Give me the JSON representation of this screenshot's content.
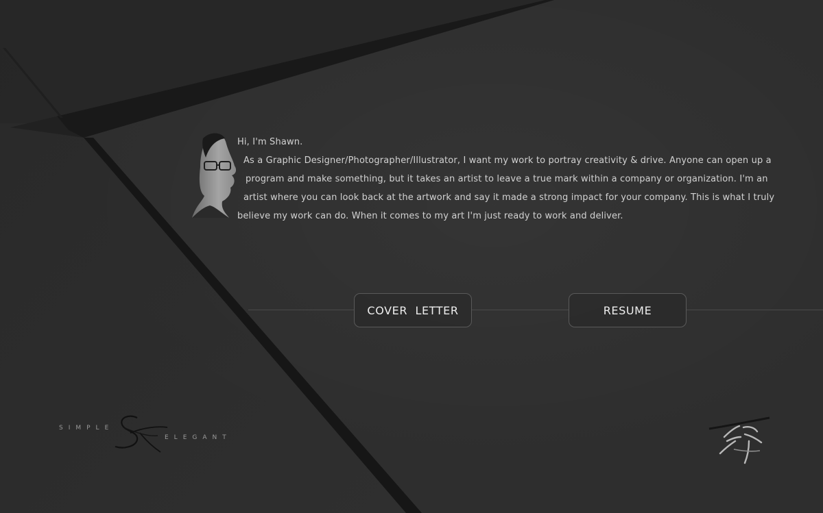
{
  "intro": {
    "greeting": "Hi, I'm Shawn.",
    "lines": [
      "As a Graphic Designer/Photographer/Illustrator, I want my work to portray creativity & drive. Anyone can open up a",
      " program and make something, but it takes an artist to leave a true mark within a company or organization. I'm an",
      "artist where you can look back at the artwork and say it made a strong impact for your company. This is what I truly",
      "believe my work can do. When it comes to my art I'm just ready to work and deliver."
    ]
  },
  "buttons": {
    "cover_letter": "COVER  LETTER",
    "resume": "RESUME"
  },
  "branding": {
    "logo_word_left": "SIMPLE",
    "logo_word_right": "ELEGANT",
    "logo_monogram": "S&E",
    "signature_mark": "冷"
  },
  "colors": {
    "background": "#2e2e2e",
    "stripe": "#1c1c1c",
    "text": "#d2d2d2",
    "button_border": "#5a5a5a"
  }
}
